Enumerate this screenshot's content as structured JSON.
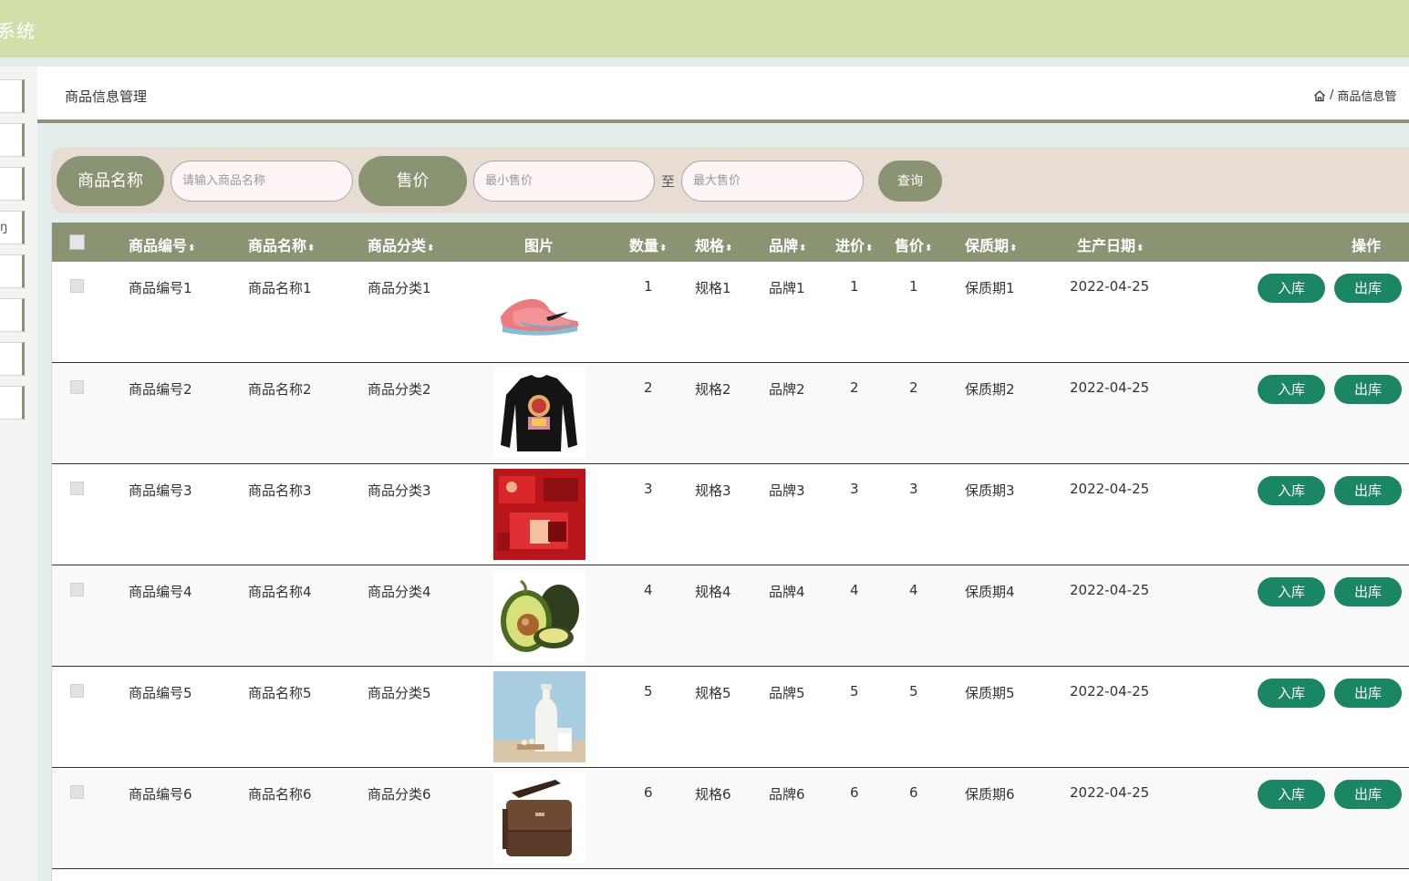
{
  "header": {
    "title": "系统"
  },
  "breadcrumb": {
    "page_title": "商品信息管理",
    "separator": "/",
    "current": "商品信息管"
  },
  "search": {
    "name_label": "商品名称",
    "name_placeholder": "请输入商品名称",
    "price_label": "售价",
    "min_placeholder": "最小售价",
    "to_label": "至",
    "max_placeholder": "最大售价",
    "query_label": "查询"
  },
  "table": {
    "columns": {
      "code": "商品编号",
      "name": "商品名称",
      "category": "商品分类",
      "image": "图片",
      "qty": "数量",
      "spec": "规格",
      "brand": "品牌",
      "cost": "进价",
      "price": "售价",
      "shelf": "保质期",
      "date": "生产日期",
      "actions": "操作"
    },
    "sort_icon": "⬍",
    "rows": [
      {
        "code": "商品编号1",
        "name": "商品名称1",
        "category": "商品分类1",
        "image": "sneaker",
        "qty": "1",
        "spec": "规格1",
        "brand": "品牌1",
        "cost": "1",
        "price": "1",
        "shelf": "保质期1",
        "date": "2022-04-25",
        "in": "入库",
        "out": "出库"
      },
      {
        "code": "商品编号2",
        "name": "商品名称2",
        "category": "商品分类2",
        "image": "sweater",
        "qty": "2",
        "spec": "规格2",
        "brand": "品牌2",
        "cost": "2",
        "price": "2",
        "shelf": "保质期2",
        "date": "2022-04-25",
        "in": "入库",
        "out": "出库"
      },
      {
        "code": "商品编号3",
        "name": "商品名称3",
        "category": "商品分类3",
        "image": "red-giftbox",
        "qty": "3",
        "spec": "规格3",
        "brand": "品牌3",
        "cost": "3",
        "price": "3",
        "shelf": "保质期3",
        "date": "2022-04-25",
        "in": "入库",
        "out": "出库"
      },
      {
        "code": "商品编号4",
        "name": "商品名称4",
        "category": "商品分类4",
        "image": "avocado",
        "qty": "4",
        "spec": "规格4",
        "brand": "品牌4",
        "cost": "4",
        "price": "4",
        "shelf": "保质期4",
        "date": "2022-04-25",
        "in": "入库",
        "out": "出库"
      },
      {
        "code": "商品编号5",
        "name": "商品名称5",
        "category": "商品分类5",
        "image": "milk",
        "qty": "5",
        "spec": "规格5",
        "brand": "品牌5",
        "cost": "5",
        "price": "5",
        "shelf": "保质期5",
        "date": "2022-04-25",
        "in": "入库",
        "out": "出库"
      },
      {
        "code": "商品编号6",
        "name": "商品名称6",
        "category": "商品分类6",
        "image": "leather-bag",
        "qty": "6",
        "spec": "规格6",
        "brand": "品牌6",
        "cost": "6",
        "price": "6",
        "shelf": "保质期6",
        "date": "2022-04-25",
        "in": "入库",
        "out": "出库"
      }
    ]
  },
  "sidebar": {
    "partial_glyph": "ŋ"
  },
  "colors": {
    "header": "#d2dfaa",
    "accent": "#8b9472",
    "button": "#1a8663",
    "search_bg": "#e8ddd4"
  }
}
